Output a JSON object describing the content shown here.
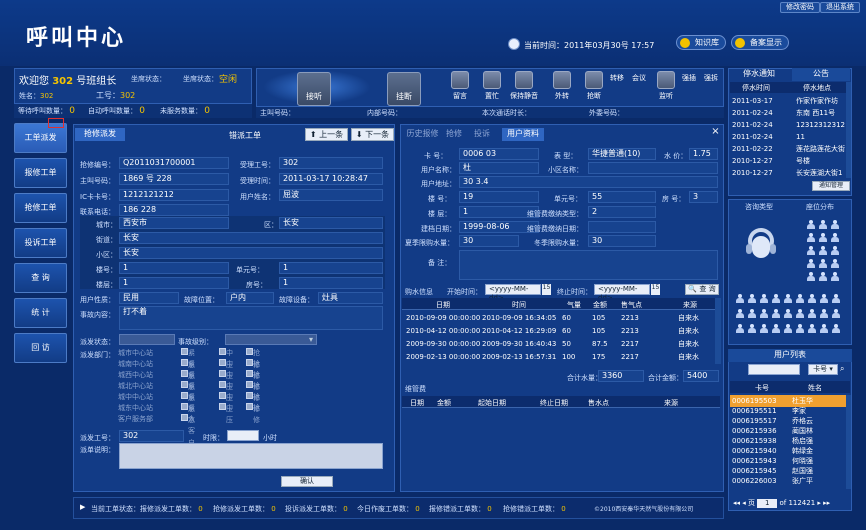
{
  "header": {
    "logo": "呼叫中心",
    "link1": "修改密码",
    "link2": "退出系统",
    "current_time_label": "当前时间：",
    "current_time": "2011年03月30号  17:57",
    "knowledge": "知识库",
    "memo": "备案显示"
  },
  "agent": {
    "welcome": "欢迎您",
    "id": "302",
    "title": "号班组长",
    "seat_state_label": "坐席状态：",
    "status_label": "坐席状态：",
    "status": "空闲",
    "name_label": "姓名：",
    "name": "302",
    "job_label": "工号：",
    "job": "302",
    "queue_label": "等待呼叫数量：",
    "queue": "0",
    "auto_label": "自动呼叫数量：",
    "auto": "0",
    "unhandled_label": "未服务数量：",
    "unhandled": "0"
  },
  "phone": {
    "answer": "接听",
    "hangup": "挂断",
    "caller_label": "主叫号码：",
    "inner_label": "内部号码：",
    "region_label": "本次通话时长：",
    "outside_label": "外委号码：",
    "tools": [
      "留言",
      "置忙",
      "保持静音",
      "外转",
      "抢断",
      "转移",
      "会议",
      "强插",
      "强拆"
    ],
    "tool_monitor": "监听"
  },
  "sidebar": [
    "工单派发",
    "报修工单",
    "抢修工单",
    "投诉工单",
    "查 询",
    "统 计",
    "回 访"
  ],
  "left_panel": {
    "tab1": "抢修派发",
    "tab2": "错派工单",
    "prev": "上一条",
    "next": "下一条",
    "fields": {
      "order_no_label": "抢修编号：",
      "order_no": "Q2011031700001",
      "accept_label": "受理工号：",
      "accept": "302",
      "caller_label": "主叫号码：",
      "caller": "1869  号  228",
      "accept_time_label": "受理时间：",
      "accept_time": "2011-03-17 10:28:47",
      "ic_label": "IC卡卡号：",
      "ic": "1212121212",
      "user_label": "用户姓名：",
      "user": "屈波",
      "contact_label": "联系电话：",
      "contact": "186        228",
      "city_label": "城市：",
      "city": "西安市",
      "district_label": "区：",
      "district": "长安",
      "street_label": "街道：",
      "street": "长安",
      "community_label": "小区：",
      "community": "长安",
      "building_label": "楼号：",
      "building": "1",
      "unit_label": "单元号：",
      "unit": "1",
      "floor_label": "楼层：",
      "floor": "1",
      "room_label": "房号：",
      "room": "1",
      "usertype_label": "用户性质：",
      "usertype": "民用",
      "fault_label": "故障位置：",
      "fault": "户内",
      "device_label": "故障设备：",
      "device": "灶具",
      "content_label": "事故内容：",
      "content": "打不着"
    },
    "dispatch": {
      "state_label": "派发状态：",
      "level_label": "事故级别：",
      "dept_label": "派发部门：",
      "depts": [
        "城市中心站",
        "城南中心站",
        "城西中心站",
        "城北中心站",
        "城中中心站",
        "城东中心站",
        "客户服务部"
      ],
      "opts": [
        "紧急",
        "中压",
        "抢修"
      ],
      "extra": "大客户部",
      "job_label": "派发工号：",
      "job": "302",
      "time_label": "时限：",
      "hour": "小时",
      "desc_label": "派单说明：",
      "confirm": "确认"
    }
  },
  "mid_panel": {
    "tabs": [
      "历史报修",
      "抢修",
      "投诉",
      "用户资料"
    ],
    "close": "×",
    "card_label": "卡 号：",
    "card": "0006     03",
    "table_label": "表 型：",
    "table": "华捷普通(10)",
    "price_label": "水 价：",
    "price": "1.75",
    "uname_label": "用户名称：",
    "uname": "杜    ",
    "community_label": "小区名称：",
    "community": "",
    "addr_label": "用户地址：",
    "addr": "30            3.4",
    "bld_label": "楼 号：",
    "bld": "19",
    "unit_label": "单元号：",
    "unit": "55",
    "room_label": "房 号：",
    "room": "3",
    "floor_label": "楼 层：",
    "floor": "1",
    "meter_label": "维管费缴纳类型：",
    "meter": "2",
    "date_label": "建档日期：",
    "date": "1999-08-06",
    "meter2_label": "维管费缴纳日期：",
    "meter2": "",
    "summer_label": "夏季限购水量：",
    "summer": "30",
    "winter_label": "冬季限购水量：",
    "winter": "30",
    "note_label": "备 注：",
    "buy_label": "购水信息",
    "start_label": "开始时间：",
    "start_ph": "<yyyy-MM-dd>",
    "end_label": "终止时间：",
    "end_ph": "<yyyy-MM-dd>",
    "query": "查 询",
    "cols": [
      "日期",
      "时间",
      "气量",
      "金额",
      "售气点",
      "来源"
    ],
    "rows": [
      [
        "2010-09-09 00:00:00",
        "2010-09-09 16:34:05",
        "60",
        "105",
        "2213",
        "自来水"
      ],
      [
        "2010-04-12 00:00:00",
        "2010-04-12 16:29:09",
        "60",
        "105",
        "2213",
        "自来水"
      ],
      [
        "2009-09-30 00:00:00",
        "2009-09-30 16:40:43",
        "50",
        "87.5",
        "2217",
        "自来水"
      ],
      [
        "2009-02-13 00:00:00",
        "2009-02-13 16:57:31",
        "100",
        "175",
        "2217",
        "自来水"
      ]
    ],
    "total_water_label": "合计水量：",
    "total_water": "3360",
    "total_money_label": "合计金额：",
    "total_money": "5400",
    "maint_label": "维管费",
    "maint_cols": [
      "日期",
      "金额",
      "起始日期",
      "终止日期",
      "售水点",
      "来源"
    ]
  },
  "right_panel": {
    "tab1": "停水通知",
    "tab2": "公告",
    "cols": [
      "停水时间",
      "停水地点"
    ],
    "rows": [
      [
        "2011-03-17",
        "作家作家作坊"
      ],
      [
        "2011-02-24",
        "东南  西11号"
      ],
      [
        "2011-02-24",
        "12312312312"
      ],
      [
        "2011-02-24",
        "11"
      ],
      [
        "2011-02-22",
        "莲花路莲花大街"
      ],
      [
        "2010-12-27",
        "号楼"
      ],
      [
        "2010-12-27",
        "长安莲湖大街1"
      ]
    ],
    "notice_btn": "通知管理",
    "seat_type": "咨询类型",
    "seat_dist": "座位分布",
    "user_list": "用户列表",
    "card_ph": "卡号",
    "ucols": [
      "卡号",
      "姓名"
    ],
    "users": [
      [
        "0006195503",
        "杜玉华"
      ],
      [
        "0006195511",
        "李家"
      ],
      [
        "0006195517",
        "乔格云"
      ],
      [
        "0006215936",
        "蔺国林"
      ],
      [
        "0006215938",
        "杨启强"
      ],
      [
        "0006215940",
        "韩绿金"
      ],
      [
        "0006215943",
        "何晓强"
      ],
      [
        "0006215945",
        "赵国强"
      ],
      [
        "0006226003",
        "张广平"
      ]
    ],
    "page": "1",
    "pages": "of 112421"
  },
  "footer": {
    "items": [
      "当前工单状态：",
      "报修派发工单数：",
      "抢修派发工单数：",
      "投诉派发工单数：",
      "今日作废工单数：",
      "报修错派工单数：",
      "抢修错派工单数："
    ],
    "count": "0",
    "copyright": "©2010西安秦华天然气股份有限公司"
  }
}
